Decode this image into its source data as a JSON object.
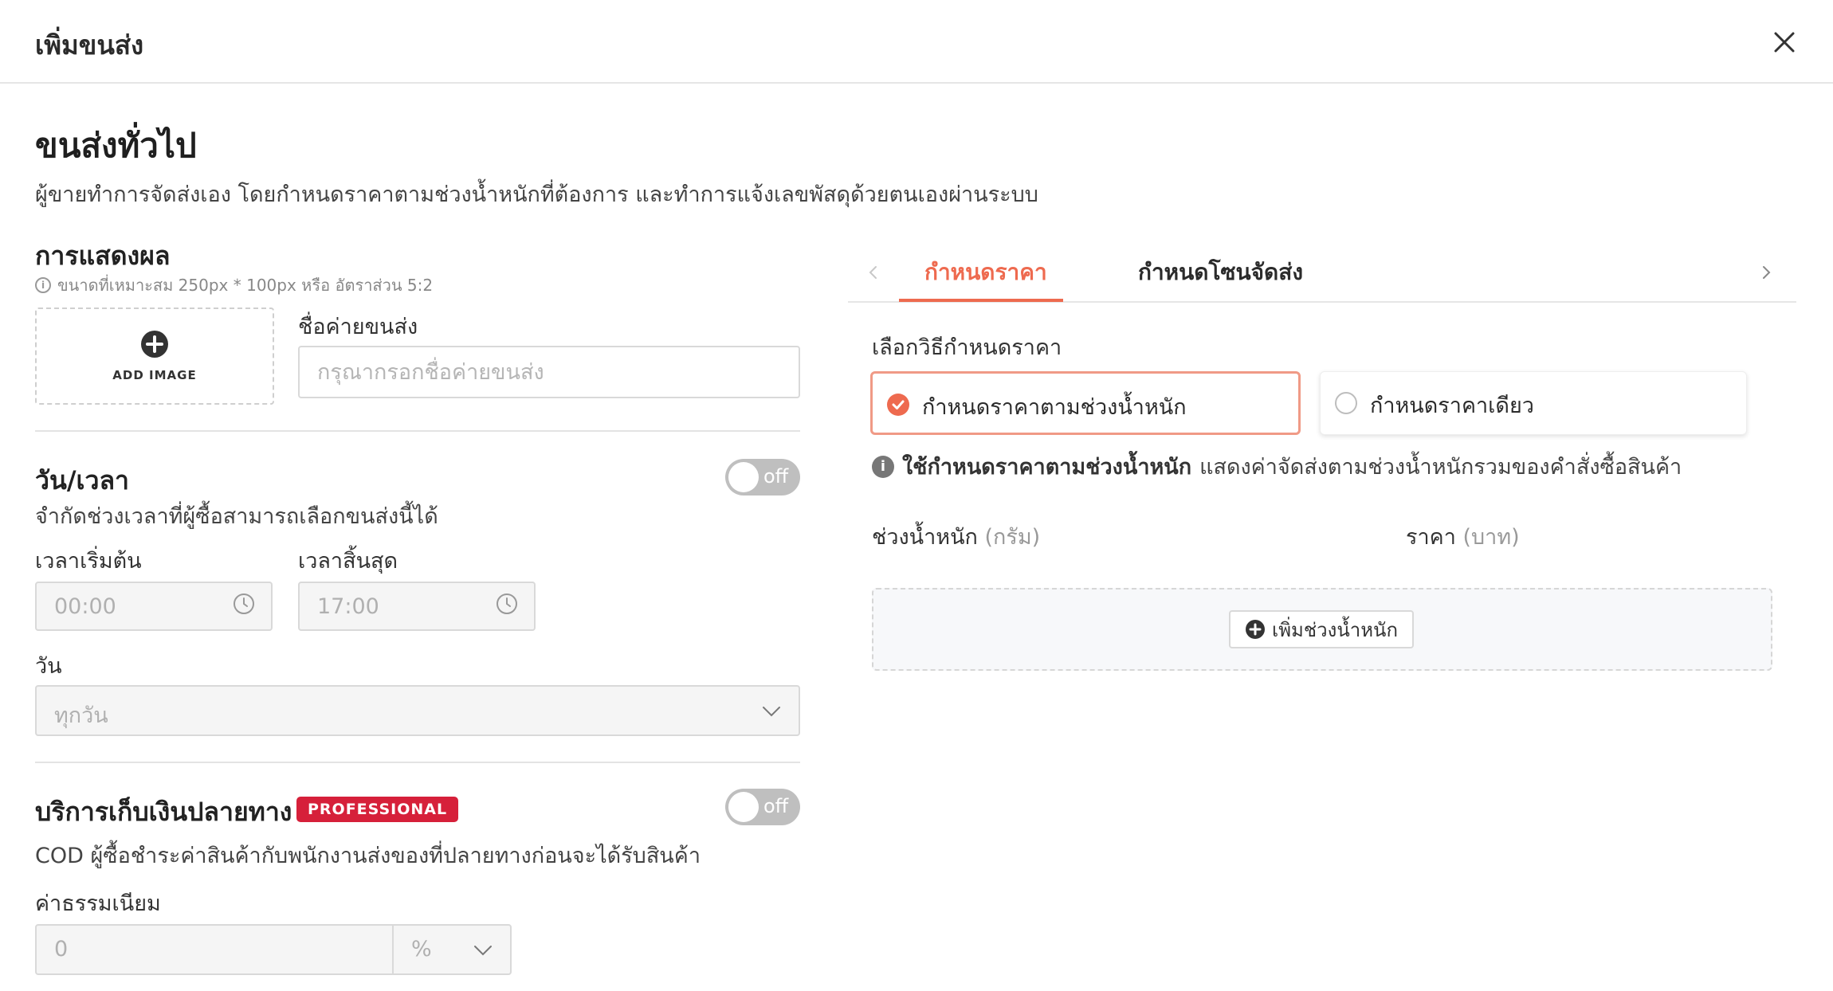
{
  "header": {
    "title": "เพิ่มขนส่ง"
  },
  "main": {
    "title": "ขนส่งทั่วไป",
    "description": "ผู้ขายทำการจัดส่งเอง โดยกำหนดราคาตามช่วงน้ำหนักที่ต้องการ และทำการแจ้งเลขพัสดุด้วยตนเองผ่านระบบ"
  },
  "display": {
    "title": "การแสดงผล",
    "hint": "ขนาดที่เหมาะสม 250px * 100px หรือ อัตราส่วน 5:2",
    "add_image_label": "ADD IMAGE",
    "carrier_name_label": "ชื่อค่ายขนส่ง",
    "carrier_name_placeholder": "กรุณากรอกชื่อค่ายขนส่ง",
    "carrier_name_value": ""
  },
  "schedule": {
    "title": "วัน/เวลา",
    "toggle_label": "off",
    "description": "จำกัดช่วงเวลาที่ผู้ซื้อสามารถเลือกขนส่งนี้ได้",
    "start_label": "เวลาเริ่มต้น",
    "start_value": "00:00",
    "end_label": "เวลาสิ้นสุด",
    "end_value": "17:00",
    "day_label": "วัน",
    "day_value": "ทุกวัน"
  },
  "cod": {
    "title": "บริการเก็บเงินปลายทาง",
    "badge": "PROFESSIONAL",
    "toggle_label": "off",
    "description": "COD ผู้ซื้อชำระค่าสินค้ากับพนักงานส่งของที่ปลายทางก่อนจะได้รับสินค้า",
    "fee_label": "ค่าธรรมเนียม",
    "fee_value": "0",
    "fee_unit": "%"
  },
  "pricing": {
    "tabs": [
      {
        "label": "กำหนดราคา",
        "active": true
      },
      {
        "label": "กำหนดโซนจัดส่ง",
        "active": false
      }
    ],
    "method_label": "เลือกวิธีกำหนดราคา",
    "options": [
      {
        "label": "กำหนดราคาตามช่วงน้ำหนัก",
        "selected": true
      },
      {
        "label": "กำหนดราคาเดียว",
        "selected": false
      }
    ],
    "info_bold": "ใช้กำหนดราคาตามช่วงน้ำหนัก",
    "info_text": "แสดงค่าจัดส่งตามช่วงน้ำหนักรวมของคำสั่งซื้อสินค้า",
    "weight_col": "ช่วงน้ำหนัก",
    "weight_unit": "(กรัม)",
    "price_col": "ราคา",
    "price_unit": "(บาท)",
    "add_weight_label": "เพิ่มช่วงน้ำหนัก"
  },
  "colors": {
    "accent": "#ee6a4f",
    "badge": "#d6203a",
    "toggle_off": "#bfbfbf"
  }
}
